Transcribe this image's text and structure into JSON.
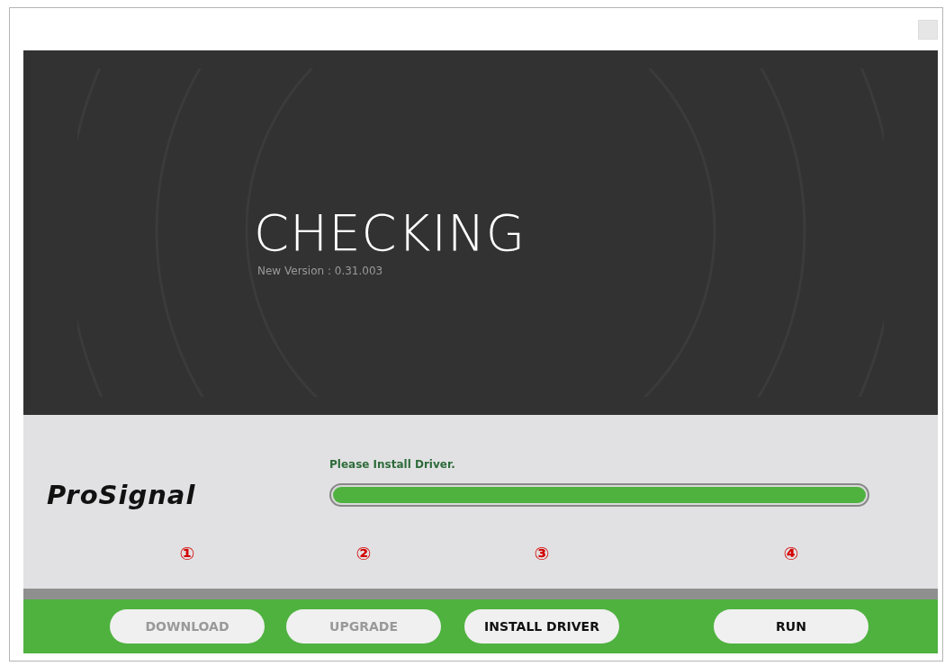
{
  "banner": {
    "status": "CHECKING",
    "version_label": "New Version :  0.31.003"
  },
  "progress": {
    "message": "Please Install Driver.",
    "logo": "ProSignal",
    "level": 1.0
  },
  "buttons": [
    {
      "step": "①",
      "label": "DOWNLOAD",
      "disabled": true
    },
    {
      "step": "②",
      "label": "UPGRADE",
      "disabled": true
    },
    {
      "step": "③",
      "label": "INSTALL DRIVER",
      "disabled": false
    },
    {
      "step": "④",
      "label": "RUN",
      "disabled": false
    }
  ]
}
